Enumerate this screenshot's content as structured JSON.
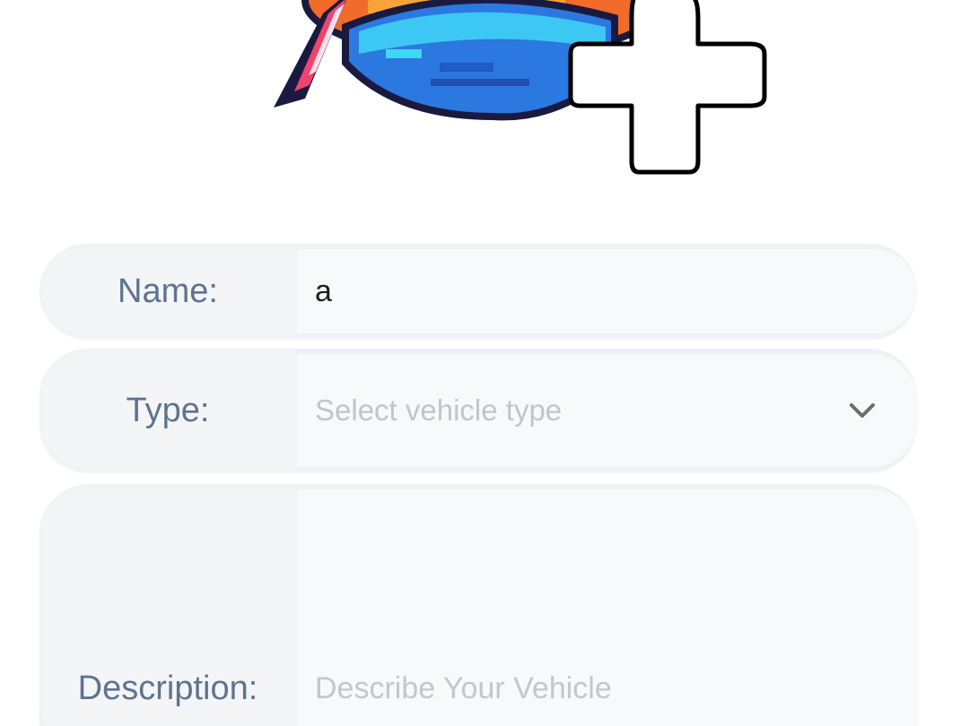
{
  "form": {
    "name": {
      "label": "Name:",
      "value": "a"
    },
    "type": {
      "label": "Type:",
      "placeholder": "Select vehicle type"
    },
    "description": {
      "label": "Description:",
      "placeholder": "Describe Your Vehicle"
    }
  },
  "icons": {
    "add_photo": "plus-icon",
    "type_dropdown": "chevron-down-icon"
  },
  "colors": {
    "label_text": "#5f7390",
    "placeholder_text": "#c2c4c9",
    "row_background": "#f0f1f4"
  }
}
